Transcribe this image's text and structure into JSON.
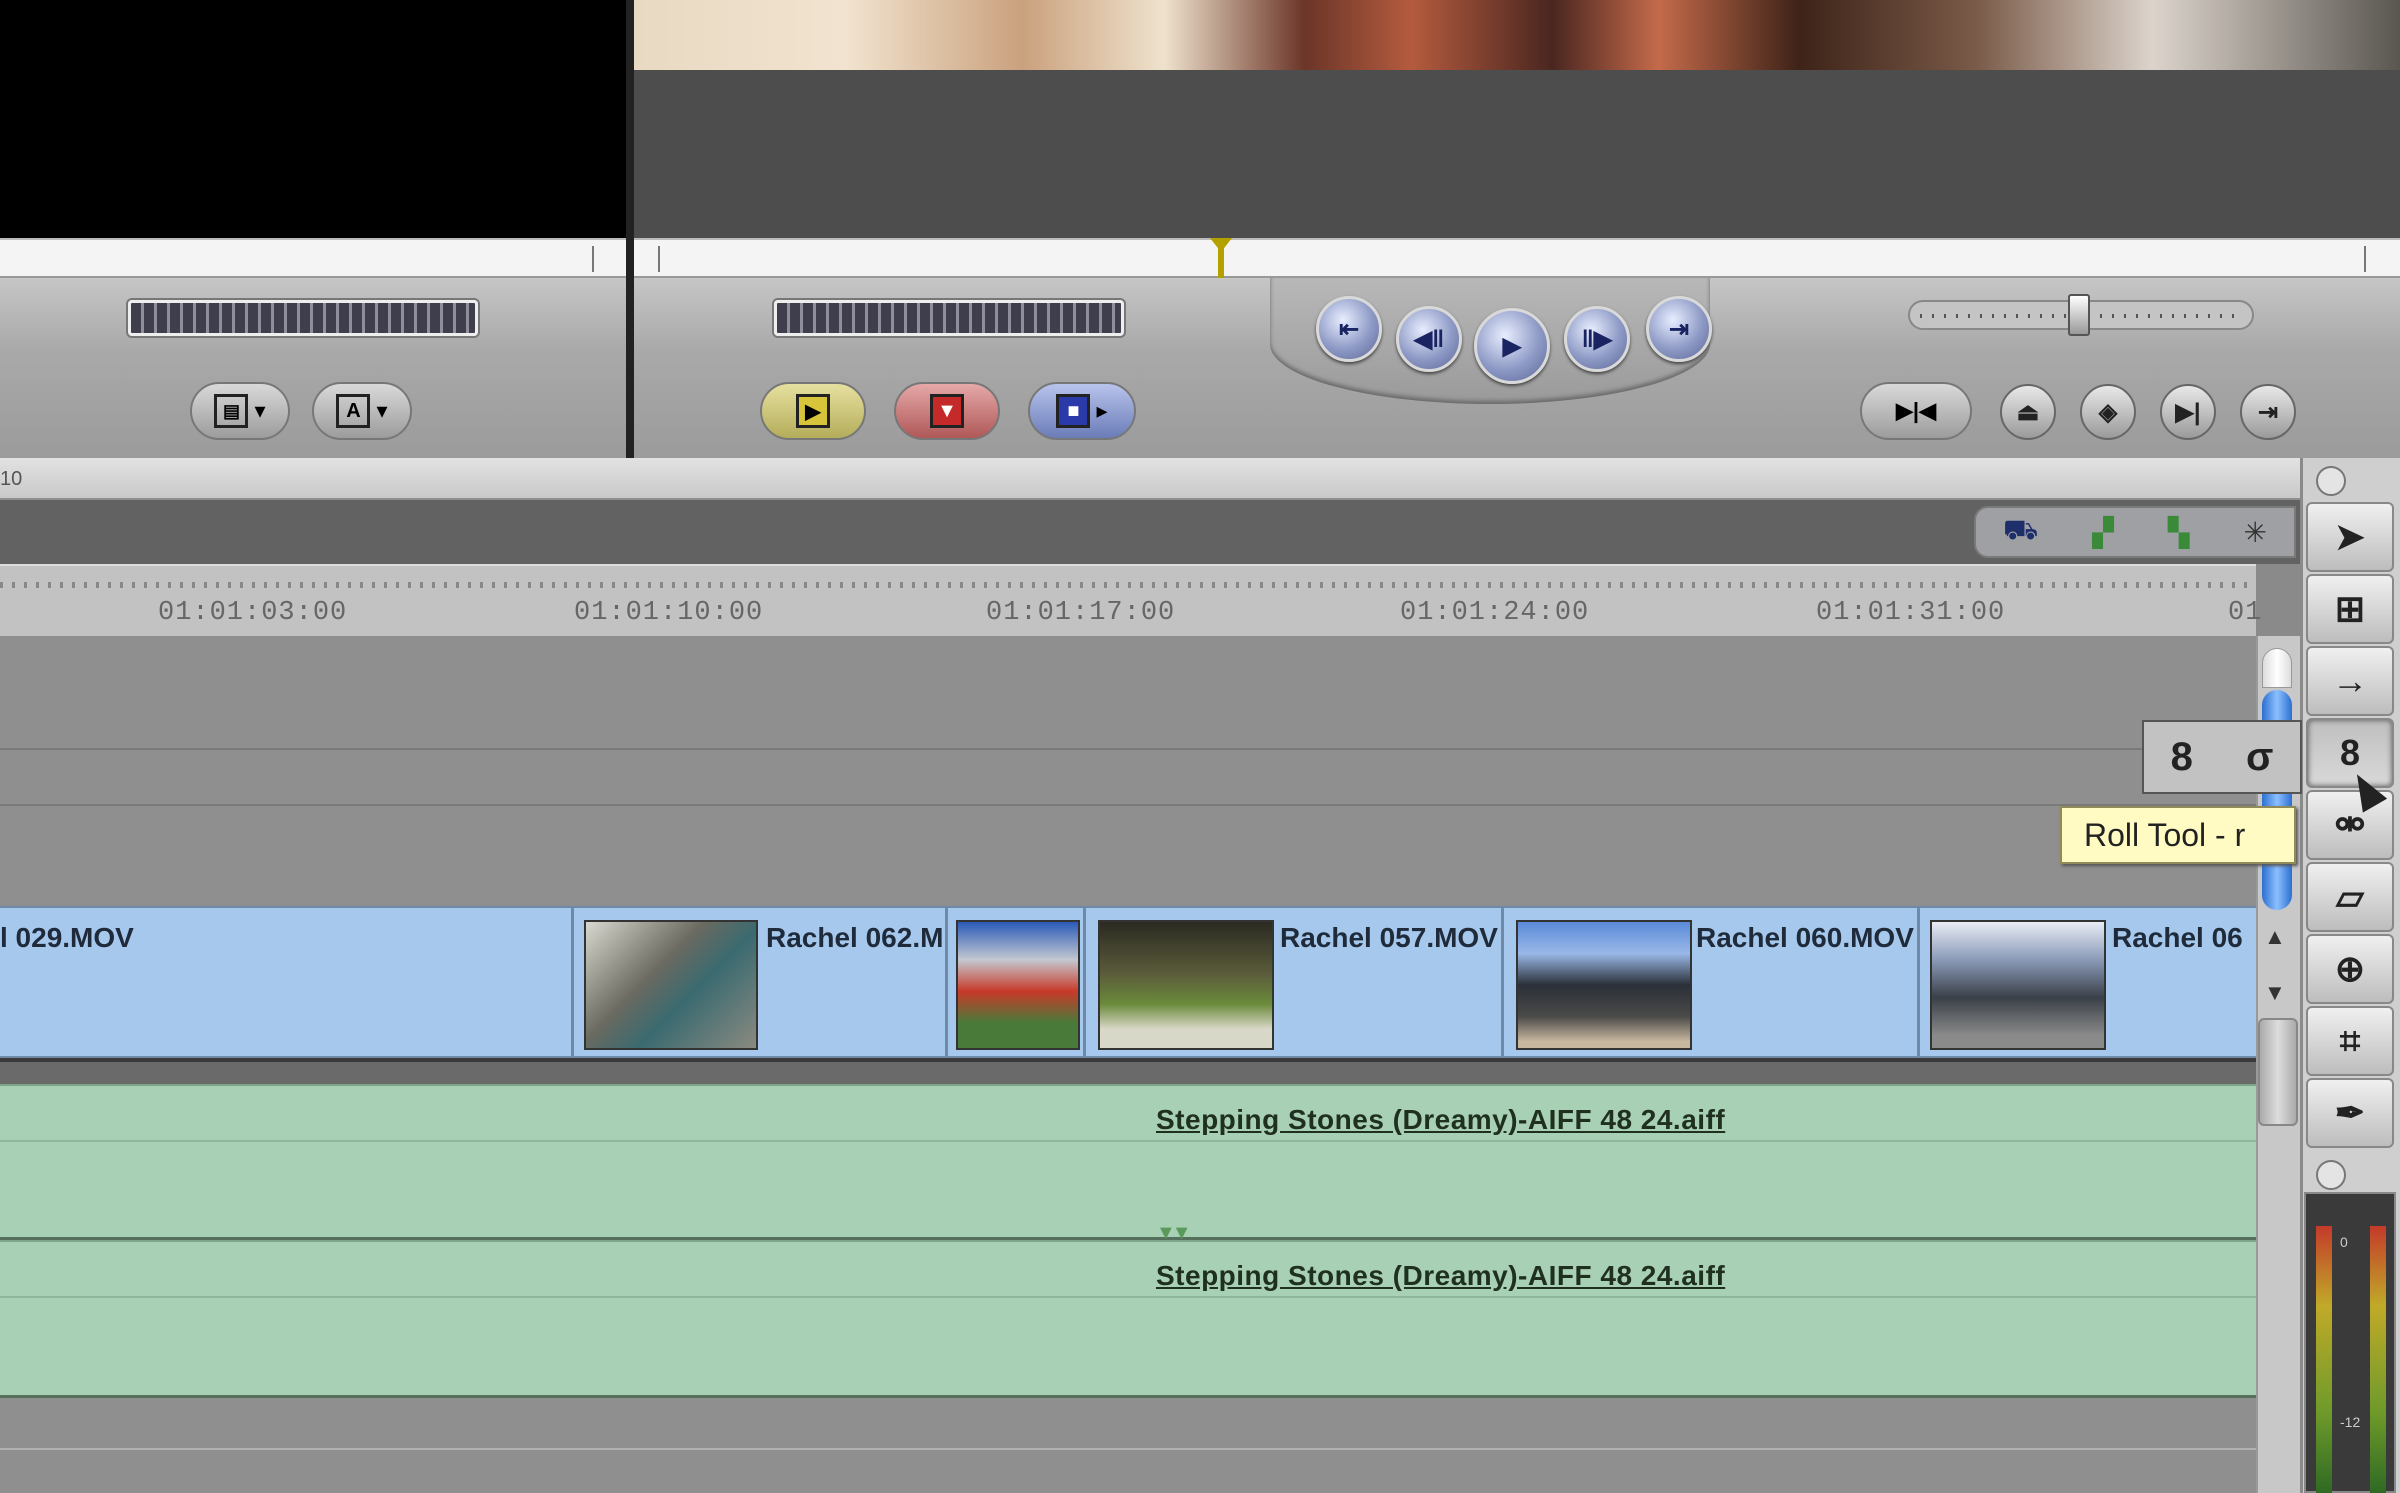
{
  "viewer": {
    "playhead_marker": "playhead"
  },
  "canvas_buttons": {
    "insert": "insert-edit-icon",
    "overwrite": "overwrite-edit-icon",
    "replace": "replace-edit-icon"
  },
  "viewer_buttons": {
    "overlay": "overlay-menu-icon",
    "text": "A"
  },
  "transport": [
    "prev-edit-icon",
    "step-back-icon",
    "play-icon",
    "step-forward-icon",
    "next-edit-icon"
  ],
  "right_controls": [
    "match-frame-icon",
    "mark-clip-icon",
    "add-marker-icon",
    "mark-in-out-icon",
    "add-keyframe-icon"
  ],
  "timeline": {
    "title_fragment": "10",
    "timecodes": [
      "01:01:03:00",
      "01:01:10:00",
      "01:01:17:00",
      "01:01:24:00",
      "01:01:31:00",
      "01"
    ],
    "video_clips": [
      {
        "name": "l 029.MOV"
      },
      {
        "name": "Rachel 062.M"
      },
      {
        "name": ""
      },
      {
        "name": "Rachel 057.MOV"
      },
      {
        "name": "Rachel 060.MOV"
      },
      {
        "name": "Rachel 06"
      }
    ],
    "audio_clips": [
      {
        "name": "Stepping Stones (Dreamy)-AIFF 48 24.aiff"
      },
      {
        "name": "Stepping Stones (Dreamy)-AIFF 48 24.aiff"
      }
    ]
  },
  "tools": [
    "selection-arrow-icon",
    "edit-selection-icon",
    "track-select-icon",
    "roll-tool-icon",
    "slip-tool-icon",
    "razor-blade-icon",
    "zoom-in-icon",
    "crop-icon",
    "pen-icon"
  ],
  "tooltip": {
    "text": "Roll Tool - r"
  },
  "meter": {
    "labels": [
      "0",
      "-12"
    ]
  },
  "colors": {
    "video_clip": "#a6c8ec",
    "audio_clip": "#a8d0b4",
    "scroll_thumb": "#2c6fd0",
    "tooltip_bg": "#fffbc2"
  }
}
